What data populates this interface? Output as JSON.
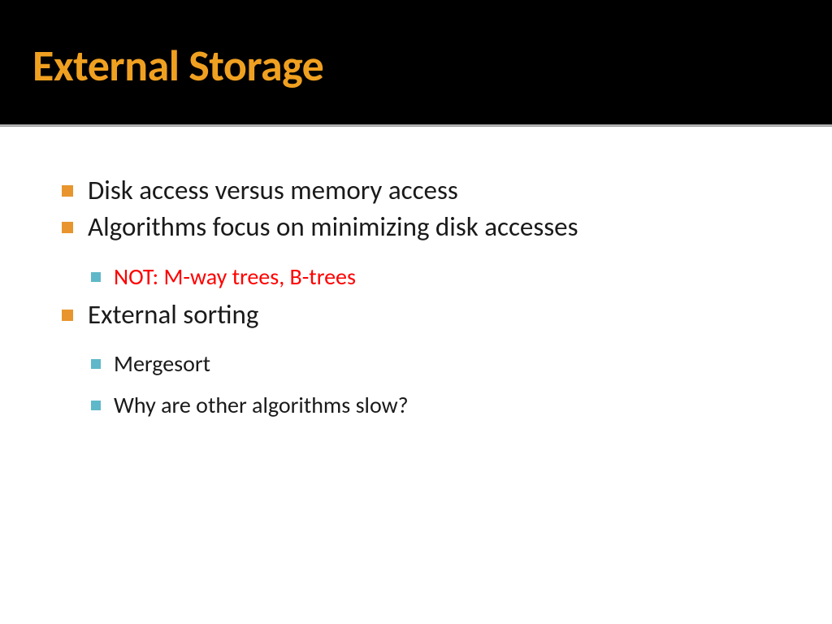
{
  "slide": {
    "title": "External Storage",
    "bullets": [
      {
        "level": 1,
        "text": "Disk access versus memory access",
        "color": "normal"
      },
      {
        "level": 1,
        "text": "Algorithms focus on minimizing disk accesses",
        "color": "normal"
      },
      {
        "level": 2,
        "text": "NOT: M-way trees, B-trees",
        "color": "red"
      },
      {
        "level": 1,
        "text": "External sorting",
        "color": "normal"
      },
      {
        "level": 2,
        "text": "Mergesort",
        "color": "normal"
      },
      {
        "level": 2,
        "text": "Why are other algorithms slow?",
        "color": "normal"
      }
    ]
  }
}
